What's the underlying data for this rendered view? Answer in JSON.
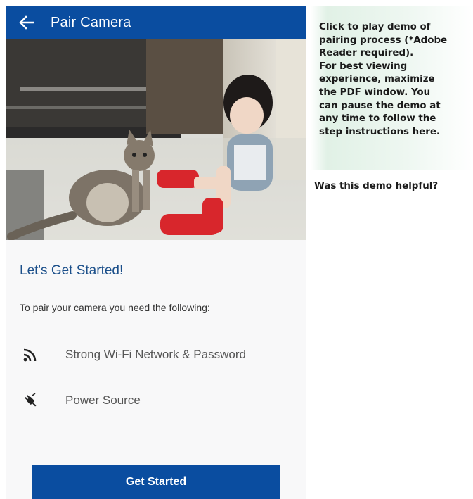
{
  "appbar": {
    "title": "Pair Camera",
    "back_icon": "arrow-left-icon",
    "color": "#0a4da0"
  },
  "hero": {
    "description_icon": "photo"
  },
  "content": {
    "heading": "Let's Get Started!",
    "subtext": "To pair your camera you need the following:",
    "requirements": [
      {
        "icon": "wifi-icon",
        "label": "Strong Wi-Fi Network & Password"
      },
      {
        "icon": "plug-icon",
        "label": "Power Source"
      }
    ],
    "button_label": "Get Started"
  },
  "info_panel": {
    "lines": [
      "Click to play demo of",
      "pairing process (*Adobe",
      "Reader required).",
      "For best viewing",
      "experience, maximize",
      "the PDF window. You",
      "can pause the demo at",
      "any time to follow the",
      "step instructions here."
    ],
    "feedback": "Was this demo helpful?"
  },
  "colors": {
    "primary": "#0a4da0",
    "heading": "#1b4f8a",
    "info_bg": "#e1f1e6"
  }
}
